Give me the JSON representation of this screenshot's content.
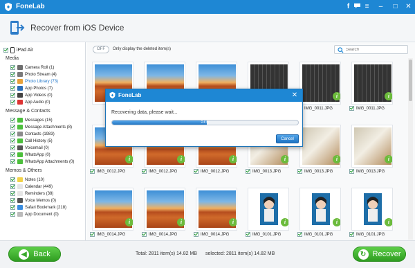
{
  "app": {
    "title": "FoneLab"
  },
  "header": {
    "title": "Recover from iOS Device"
  },
  "sidebar": {
    "device": "iPad Air",
    "sections": [
      {
        "title": "Media",
        "items": [
          {
            "label": "Camera Roll (1)",
            "icon": "camera-icon",
            "color": "#6e6e6e"
          },
          {
            "label": "Photo Stream (4)",
            "icon": "photo-stream-icon",
            "color": "#7a7a7a"
          },
          {
            "label": "Photo Library (73)",
            "icon": "photo-library-icon",
            "color": "#e8a23a",
            "active": true
          },
          {
            "label": "App Photos (7)",
            "icon": "app-photos-icon",
            "color": "#2c6fb8"
          },
          {
            "label": "App Videos (0)",
            "icon": "app-videos-icon",
            "color": "#444"
          },
          {
            "label": "App Audio (0)",
            "icon": "app-audio-icon",
            "color": "#d33"
          }
        ]
      },
      {
        "title": "Message & Contacts",
        "items": [
          {
            "label": "Messages (15)",
            "icon": "messages-icon",
            "color": "#4cbf3c"
          },
          {
            "label": "Message Attachments (8)",
            "icon": "attachment-icon",
            "color": "#4cbf3c"
          },
          {
            "label": "Contacts (1983)",
            "icon": "contacts-icon",
            "color": "#8a8a8a"
          },
          {
            "label": "Call History (5)",
            "icon": "call-icon",
            "color": "#4cbf3c"
          },
          {
            "label": "Voicemail (0)",
            "icon": "voicemail-icon",
            "color": "#555"
          },
          {
            "label": "WhatsApp (0)",
            "icon": "whatsapp-icon",
            "color": "#4cbf3c"
          },
          {
            "label": "WhatsApp Attachments (0)",
            "icon": "whatsapp-attachment-icon",
            "color": "#4cbf3c"
          }
        ]
      },
      {
        "title": "Memos & Others",
        "items": [
          {
            "label": "Notes (10)",
            "icon": "notes-icon",
            "color": "#f2d24a"
          },
          {
            "label": "Calendar (449)",
            "icon": "calendar-icon",
            "color": "#e6e6e6"
          },
          {
            "label": "Reminders (38)",
            "icon": "reminders-icon",
            "color": "#e6e6e6"
          },
          {
            "label": "Voice Memos (0)",
            "icon": "voice-memos-icon",
            "color": "#555"
          },
          {
            "label": "Safari Bookmark (218)",
            "icon": "safari-icon",
            "color": "#3a8de0"
          },
          {
            "label": "App Document (0)",
            "icon": "app-document-icon",
            "color": "#bbb"
          }
        ]
      }
    ]
  },
  "toolbar": {
    "toggle_state": "OFF",
    "toggle_label": "Only display the deleted item(s)",
    "search_placeholder": "Search"
  },
  "photos": [
    {
      "name": "",
      "kind": "desert",
      "checked": false
    },
    {
      "name": "",
      "kind": "desert",
      "checked": false
    },
    {
      "name": "",
      "kind": "desert",
      "checked": false
    },
    {
      "name": "",
      "kind": "kb",
      "checked": false
    },
    {
      "name": "IMG_0011.JPG",
      "kind": "kb",
      "checked": true
    },
    {
      "name": "IMG_0011.JPG",
      "kind": "kb",
      "checked": true
    },
    {
      "name": "IMG_0012.JPG",
      "kind": "desert",
      "checked": true
    },
    {
      "name": "IMG_0012.JPG",
      "kind": "desert",
      "checked": true
    },
    {
      "name": "IMG_0012.JPG",
      "kind": "desert",
      "checked": true
    },
    {
      "name": "IMG_0013.JPG",
      "kind": "office",
      "checked": true
    },
    {
      "name": "IMG_0013.JPG",
      "kind": "office",
      "checked": true
    },
    {
      "name": "IMG_0013.JPG",
      "kind": "office",
      "checked": true
    },
    {
      "name": "IMG_0014.JPG",
      "kind": "desert",
      "checked": true
    },
    {
      "name": "IMG_0014.JPG",
      "kind": "desert",
      "checked": true
    },
    {
      "name": "IMG_0014.JPG",
      "kind": "desert",
      "checked": true
    },
    {
      "name": "IMG_0101.JPG",
      "kind": "girl",
      "checked": true
    },
    {
      "name": "IMG_0101.JPG",
      "kind": "girl",
      "checked": true
    },
    {
      "name": "IMG_0101.JPG",
      "kind": "girl",
      "checked": true
    }
  ],
  "dialog": {
    "title": "FoneLab",
    "message": "Recovering data, please wait...",
    "progress_percent": 51,
    "progress_text": "51%",
    "cancel_label": "Cancel"
  },
  "footer": {
    "back_label": "Back",
    "total_text": "Total: 2811 item(s) 14.82 MB",
    "selected_text": "selected: 2811 item(s) 14.82 MB",
    "recover_label": "Recover"
  },
  "colors": {
    "accent": "#1e87d4",
    "green": "#4cb83a"
  }
}
